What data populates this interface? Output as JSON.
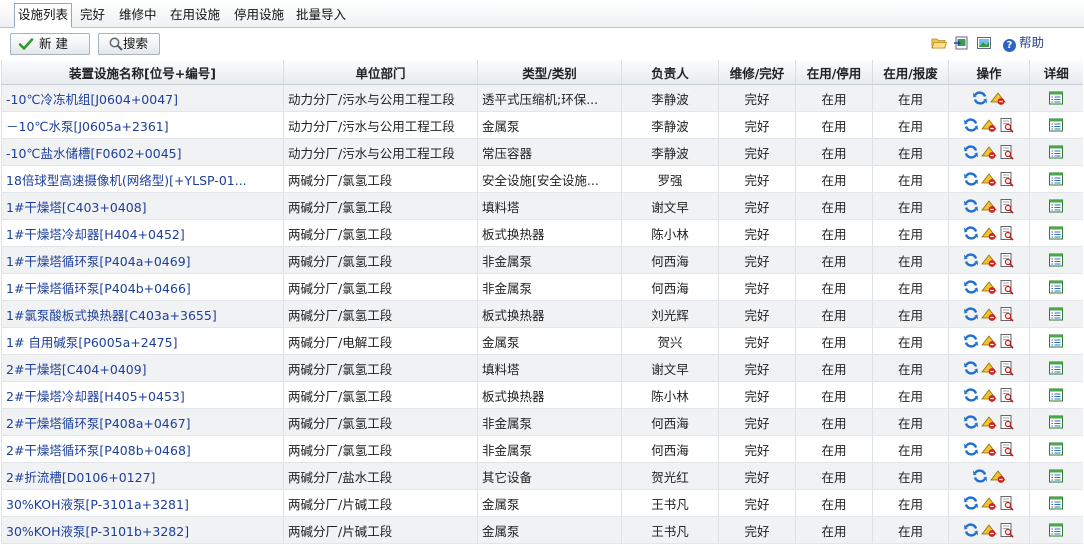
{
  "tabs": [
    {
      "label": "设施列表",
      "active": true
    },
    {
      "label": "完好",
      "active": false
    },
    {
      "label": "维修中",
      "active": false
    },
    {
      "label": "在用设施",
      "active": false
    },
    {
      "label": "停用设施",
      "active": false
    },
    {
      "label": "批量导入",
      "active": false
    }
  ],
  "toolbar": {
    "new_label": "新 建",
    "search_label": "搜索",
    "help_label": "帮助",
    "icons": [
      "folder-open-icon",
      "import-icon",
      "export-image-icon"
    ]
  },
  "table": {
    "columns": [
      "装置设施名称[位号+编号]",
      "单位部门",
      "类型/类别",
      "负责人",
      "维修/完好",
      "在用/停用",
      "在用/报废",
      "操作",
      "详细"
    ],
    "rows": [
      {
        "name": "-10℃冷冻机组[J0604+0047]",
        "dept": "动力分厂/污水与公用工程工段",
        "type": "透平式压缩机;环保...",
        "owner": "李静波",
        "repair": "完好",
        "use": "在用",
        "scrap": "在用",
        "ops": [
          "refresh",
          "edit"
        ]
      },
      {
        "name": "－10℃水泵[J0605a+2361]",
        "dept": "动力分厂/污水与公用工程工段",
        "type": "金属泵",
        "owner": "李静波",
        "repair": "完好",
        "use": "在用",
        "scrap": "在用",
        "ops": [
          "refresh",
          "edit",
          "view"
        ]
      },
      {
        "name": "-10℃盐水储槽[F0602+0045]",
        "dept": "动力分厂/污水与公用工程工段",
        "type": "常压容器",
        "owner": "李静波",
        "repair": "完好",
        "use": "在用",
        "scrap": "在用",
        "ops": [
          "refresh",
          "edit",
          "view"
        ]
      },
      {
        "name": "18倍球型高速摄像机(网络型)[+YLSP-01...",
        "dept": "两碱分厂/氯氢工段",
        "type": "安全设施[安全设施...",
        "owner": "罗强",
        "repair": "完好",
        "use": "在用",
        "scrap": "在用",
        "ops": [
          "refresh",
          "edit",
          "view"
        ]
      },
      {
        "name": "1#干燥塔[C403+0408]",
        "dept": "两碱分厂/氯氢工段",
        "type": "填料塔",
        "owner": "谢文早",
        "repair": "完好",
        "use": "在用",
        "scrap": "在用",
        "ops": [
          "refresh",
          "edit",
          "view"
        ]
      },
      {
        "name": "1#干燥塔冷却器[H404+0452]",
        "dept": "两碱分厂/氯氢工段",
        "type": "板式换热器",
        "owner": "陈小林",
        "repair": "完好",
        "use": "在用",
        "scrap": "在用",
        "ops": [
          "refresh",
          "edit",
          "view"
        ]
      },
      {
        "name": "1#干燥塔循环泵[P404a+0469]",
        "dept": "两碱分厂/氯氢工段",
        "type": "非金属泵",
        "owner": "何西海",
        "repair": "完好",
        "use": "在用",
        "scrap": "在用",
        "ops": [
          "refresh",
          "edit",
          "view"
        ]
      },
      {
        "name": "1#干燥塔循环泵[P404b+0466]",
        "dept": "两碱分厂/氯氢工段",
        "type": "非金属泵",
        "owner": "何西海",
        "repair": "完好",
        "use": "在用",
        "scrap": "在用",
        "ops": [
          "refresh",
          "edit",
          "view"
        ]
      },
      {
        "name": "1#氯泵酸板式换热器[C403a+3655]",
        "dept": "两碱分厂/氯氢工段",
        "type": "板式换热器",
        "owner": "刘光辉",
        "repair": "完好",
        "use": "在用",
        "scrap": "在用",
        "ops": [
          "refresh",
          "edit",
          "view"
        ]
      },
      {
        "name": "1# 自用碱泵[P6005a+2475]",
        "dept": "两碱分厂/电解工段",
        "type": "金属泵",
        "owner": "贺兴",
        "repair": "完好",
        "use": "在用",
        "scrap": "在用",
        "ops": [
          "refresh",
          "edit",
          "view"
        ]
      },
      {
        "name": "2#干燥塔[C404+0409]",
        "dept": "两碱分厂/氯氢工段",
        "type": "填料塔",
        "owner": "谢文早",
        "repair": "完好",
        "use": "在用",
        "scrap": "在用",
        "ops": [
          "refresh",
          "edit",
          "view"
        ]
      },
      {
        "name": "2#干燥塔冷却器[H405+0453]",
        "dept": "两碱分厂/氯氢工段",
        "type": "板式换热器",
        "owner": "陈小林",
        "repair": "完好",
        "use": "在用",
        "scrap": "在用",
        "ops": [
          "refresh",
          "edit",
          "view"
        ]
      },
      {
        "name": "2#干燥塔循环泵[P408a+0467]",
        "dept": "两碱分厂/氯氢工段",
        "type": "非金属泵",
        "owner": "何西海",
        "repair": "完好",
        "use": "在用",
        "scrap": "在用",
        "ops": [
          "refresh",
          "edit",
          "view"
        ]
      },
      {
        "name": "2#干燥塔循环泵[P408b+0468]",
        "dept": "两碱分厂/氯氢工段",
        "type": "非金属泵",
        "owner": "何西海",
        "repair": "完好",
        "use": "在用",
        "scrap": "在用",
        "ops": [
          "refresh",
          "edit",
          "view"
        ]
      },
      {
        "name": "2#折流槽[D0106+0127]",
        "dept": "两碱分厂/盐水工段",
        "type": "其它设备",
        "owner": "贺光红",
        "repair": "完好",
        "use": "在用",
        "scrap": "在用",
        "ops": [
          "refresh",
          "edit"
        ]
      },
      {
        "name": "30%KOH液泵[P-3101a+3281]",
        "dept": "两碱分厂/片碱工段",
        "type": "金属泵",
        "owner": "王书凡",
        "repair": "完好",
        "use": "在用",
        "scrap": "在用",
        "ops": [
          "refresh",
          "edit",
          "view"
        ]
      },
      {
        "name": "30%KOH液泵[P-3101b+3282]",
        "dept": "两碱分厂/片碱工段",
        "type": "金属泵",
        "owner": "王书凡",
        "repair": "完好",
        "use": "在用",
        "scrap": "在用",
        "ops": [
          "refresh",
          "edit",
          "view"
        ]
      }
    ]
  }
}
